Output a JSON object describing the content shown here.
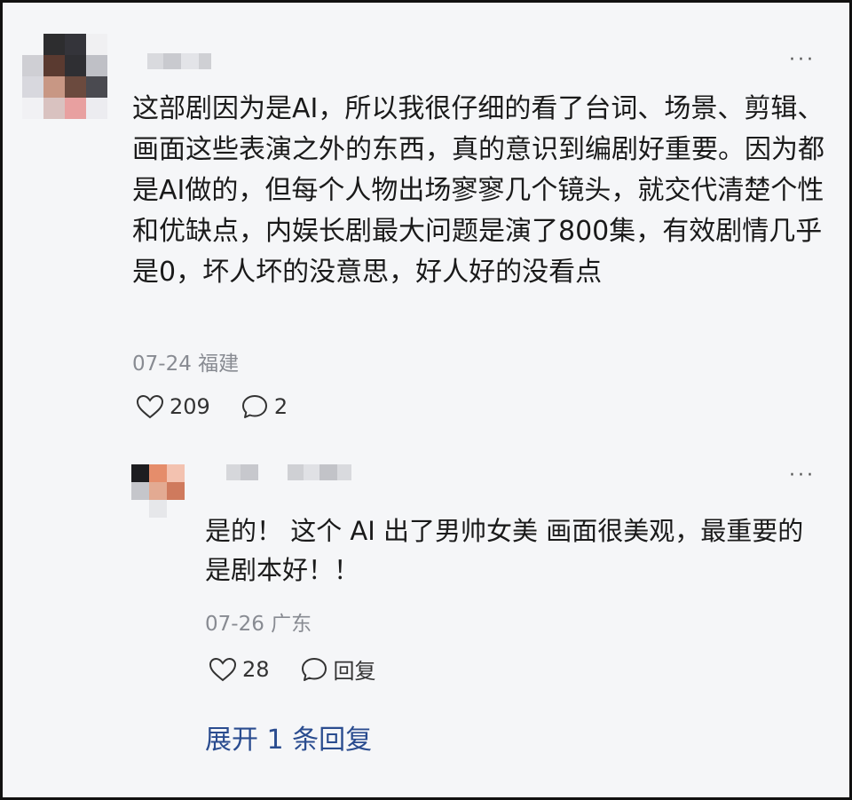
{
  "comment": {
    "text": "这部剧因为是AI，所以我很仔细的看了台词、场景、剪辑、画面这些表演之外的东西，真的意识到编剧好重要。因为都是AI做的，但每个人物出场寥寥几个镜头，就交代清楚个性和优缺点，内娱长剧最大问题是演了800集，有效剧情几乎是0，坏人坏的没意思，好人好的没看点",
    "date": "07-24",
    "location": "福建",
    "likes": "209",
    "replies": "2",
    "more_icon": "more-dots-icon",
    "like_icon": "heart-icon",
    "reply_icon": "chat-bubble-icon"
  },
  "reply": {
    "text": "是的！ 这个 AI 出了男帅女美 画面很美观，最重要的是剧本好！！",
    "date": "07-26",
    "location": "广东",
    "likes": "28",
    "reply_label": "回复"
  },
  "expand_label": "展开 1 条回复",
  "colors": {
    "background": "#f5f6f8",
    "meta_text": "#888b92",
    "link": "#2a4c8f"
  }
}
